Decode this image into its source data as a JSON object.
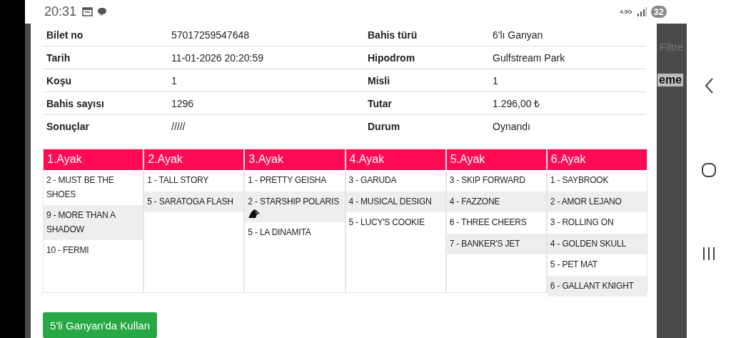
{
  "status_bar": {
    "time": "20:31",
    "network": "4.5G",
    "battery": "32"
  },
  "background": {
    "texts": [
      "Filtre",
      "eme"
    ]
  },
  "details": [
    {
      "label": "Bilet no",
      "value": "57017259547648",
      "label2": "Bahis türü",
      "value2": "6'lı Ganyan"
    },
    {
      "label": "Tarih",
      "value": "11-01-2026 20:20:59",
      "label2": "Hipodrom",
      "value2": "Gulfstream Park"
    },
    {
      "label": "Koşu",
      "value": "1",
      "label2": "Misli",
      "value2": "1"
    },
    {
      "label": "Bahis sayısı",
      "value": "1296",
      "label2": "Tutar",
      "value2": "1.296,00 ₺"
    },
    {
      "label": "Sonuçlar",
      "value": "/////",
      "label2": "Durum",
      "value2": "Oynandı"
    }
  ],
  "legs": [
    {
      "title": "1.Ayak",
      "horses": [
        {
          "name": "2 - MUST BE THE SHOES",
          "kind": "plain"
        },
        {
          "name": "9 - MORE THAN A SHADOW",
          "kind": "plain"
        },
        {
          "name": "10 - FERMI",
          "kind": "plain"
        }
      ]
    },
    {
      "title": "2.Ayak",
      "horses": [
        {
          "name": "1 - TALL STORY",
          "kind": "plain"
        },
        {
          "name": "5 - SARATOGA FLASH",
          "kind": "plain"
        }
      ]
    },
    {
      "title": "3.Ayak",
      "horses": [
        {
          "name": "1 - PRETTY GEISHA",
          "kind": "plain"
        },
        {
          "name": "2 - STARSHIP POLARIS",
          "kind": "icon"
        },
        {
          "name": "5 - LA DINAMITA",
          "kind": "plain"
        }
      ]
    },
    {
      "title": "4.Ayak",
      "horses": [
        {
          "name": "3 - GARUDA",
          "kind": "plain"
        },
        {
          "name": "4 - MUSICAL DESIGN",
          "kind": "plain"
        },
        {
          "name": "5 - LUCY'S COOKIE",
          "kind": "plain"
        }
      ]
    },
    {
      "title": "5.Ayak",
      "horses": [
        {
          "name": "3 - SKIP FORWARD",
          "kind": "plain"
        },
        {
          "name": "4 - FAZZONE",
          "kind": "plain"
        },
        {
          "name": "6 - THREE CHEERS",
          "kind": "plain"
        },
        {
          "name": "7 - BANKER'S JET",
          "kind": "plain"
        }
      ]
    },
    {
      "title": "6.Ayak",
      "horses": [
        {
          "name": "1 - SAYBROOK",
          "kind": "plain"
        },
        {
          "name": "2 - AMOR LEJANO",
          "kind": "plain"
        },
        {
          "name": "3 - ROLLING ON",
          "kind": "plain"
        },
        {
          "name": "4 - GOLDEN SKULL",
          "kind": "plain"
        },
        {
          "name": "5 - PET MAT",
          "kind": "plain"
        },
        {
          "name": "6 - GALLANT KNIGHT",
          "kind": "plain"
        }
      ]
    }
  ],
  "action_button": "5'li Ganyan'da Kullan"
}
